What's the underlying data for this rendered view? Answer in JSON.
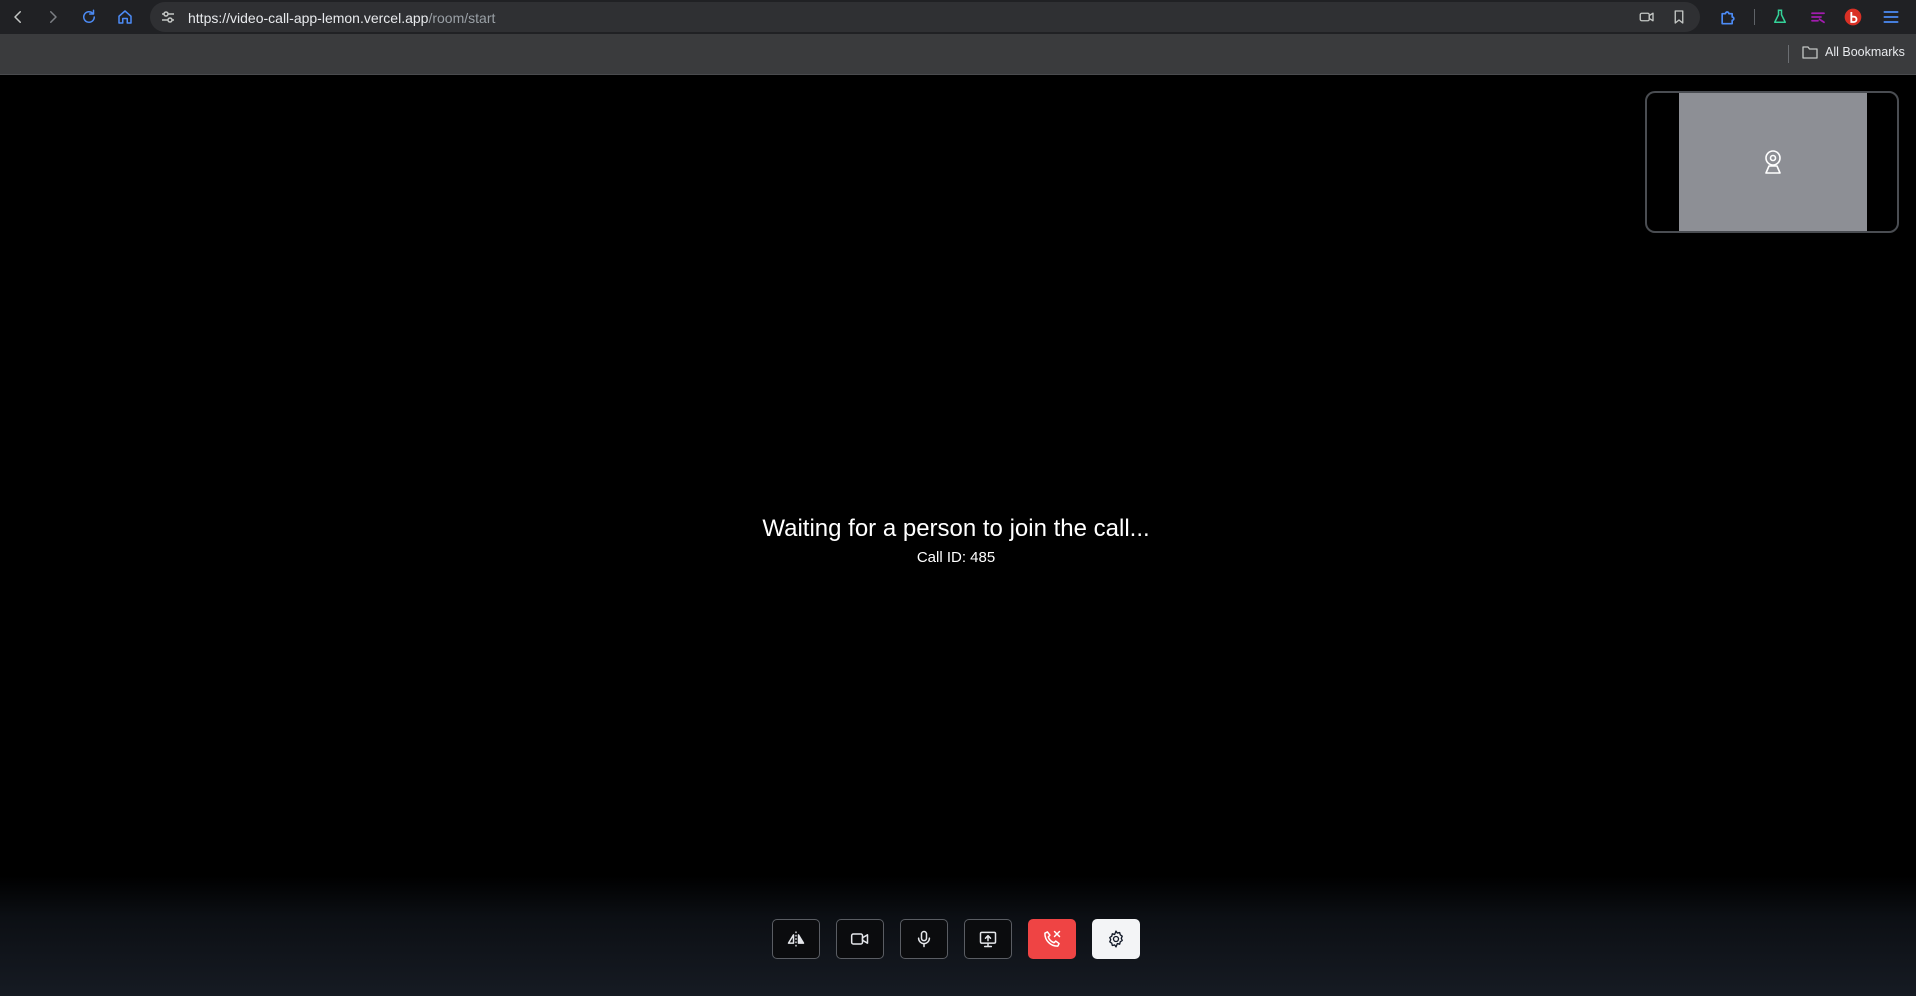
{
  "browser": {
    "url_host": "https://video-call-app-lemon.vercel.app",
    "url_path": "/room/start",
    "all_bookmarks_label": "All Bookmarks",
    "icons": {
      "back": "chevron-left-icon",
      "forward": "chevron-right-icon",
      "reload": "reload-icon",
      "home": "home-icon",
      "site_info": "tune-icon",
      "camera": "camera-icon",
      "bookmark": "bookmark-icon",
      "extensions": "puzzle-icon",
      "labs": "flask-icon",
      "menu": "hamburger-icon"
    }
  },
  "call": {
    "waiting_message": "Waiting for a person to join the call...",
    "call_id_text": "Call ID: 485"
  },
  "controls": [
    {
      "name": "flip-camera-button",
      "icon": "flip-icon"
    },
    {
      "name": "toggle-video-button",
      "icon": "video-camera-icon"
    },
    {
      "name": "toggle-mic-button",
      "icon": "microphone-icon"
    },
    {
      "name": "share-screen-button",
      "icon": "screen-share-icon"
    },
    {
      "name": "end-call-button",
      "icon": "phone-off-icon"
    },
    {
      "name": "settings-button",
      "icon": "gear-icon"
    }
  ],
  "colors": {
    "end_call": "#ef4444",
    "settings_bg": "#f3f4f6",
    "browser_accent": "#4c8bf5"
  }
}
